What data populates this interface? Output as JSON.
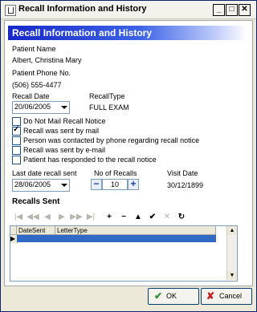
{
  "window": {
    "title": "Recall Information and History"
  },
  "banner": {
    "title": "Recall Information and History"
  },
  "patient": {
    "name_label": "Patient Name",
    "name": "Albert, Christina Mary",
    "phone_label": "Patient Phone No.",
    "phone": "(506) 555-4477"
  },
  "recall": {
    "date_label": "Recall Date",
    "date": "20/06/2005",
    "type_label": "RecallType",
    "type": "FULL EXAM"
  },
  "checks": [
    {
      "label": "Do Not Mail Recall Notice",
      "checked": false
    },
    {
      "label": "Recall was sent by mail",
      "checked": true
    },
    {
      "label": "Person was contacted by phone regarding recall notice",
      "checked": false
    },
    {
      "label": "Recall was sent by e-mail",
      "checked": false
    },
    {
      "label": "Patient has responded to the recall notice",
      "checked": false
    }
  ],
  "last_sent": {
    "label": "Last date recall sent",
    "date": "28/06/2005"
  },
  "num_recalls": {
    "label": "No of Recalls",
    "value": "10",
    "minus": "−",
    "plus": "+"
  },
  "visit": {
    "label": "Visit Date",
    "date": "30/12/1899"
  },
  "recalls_sent": {
    "title": "Recalls Sent",
    "nav": [
      "|◀",
      "◀◀",
      "◀",
      "▶",
      "▶▶",
      "▶|",
      "+",
      "−",
      "▲",
      "✔",
      "✕",
      "↻"
    ],
    "columns": [
      "DateSent",
      "LetterType"
    ],
    "row_indicator": "▶"
  },
  "buttons": {
    "ok": "OK",
    "cancel": "Cancel"
  }
}
